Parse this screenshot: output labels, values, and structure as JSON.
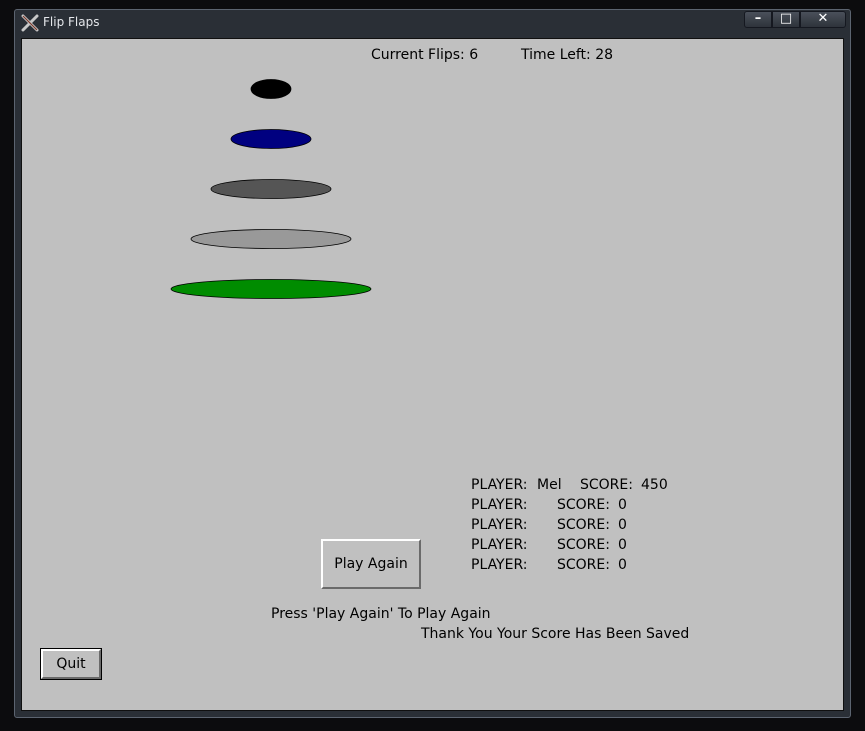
{
  "window": {
    "title": "Flip Flaps",
    "controls": {
      "minimize": "–",
      "maximize": "□",
      "close": "✕"
    }
  },
  "hud": {
    "flips_label": "Current Flips: 6",
    "time_label": "Time Left: 28"
  },
  "disks": [
    {
      "color": "#000000",
      "size": 1
    },
    {
      "color": "#000080",
      "size": 2
    },
    {
      "color": "#555555",
      "size": 3
    },
    {
      "color": "#999999",
      "size": 4
    },
    {
      "color": "#008c00",
      "size": 5
    }
  ],
  "scoreboard": {
    "player_label": "PLAYER:",
    "score_label": "SCORE:",
    "rows": [
      {
        "player": "Mel",
        "score": "450"
      },
      {
        "player": "",
        "score": "0"
      },
      {
        "player": "",
        "score": "0"
      },
      {
        "player": "",
        "score": "0"
      },
      {
        "player": "",
        "score": "0"
      }
    ]
  },
  "buttons": {
    "play_again": "Play Again",
    "quit": "Quit"
  },
  "messages": {
    "prompt": "Press 'Play Again' To Play Again",
    "saved": "Thank You Your Score Has Been Saved"
  }
}
